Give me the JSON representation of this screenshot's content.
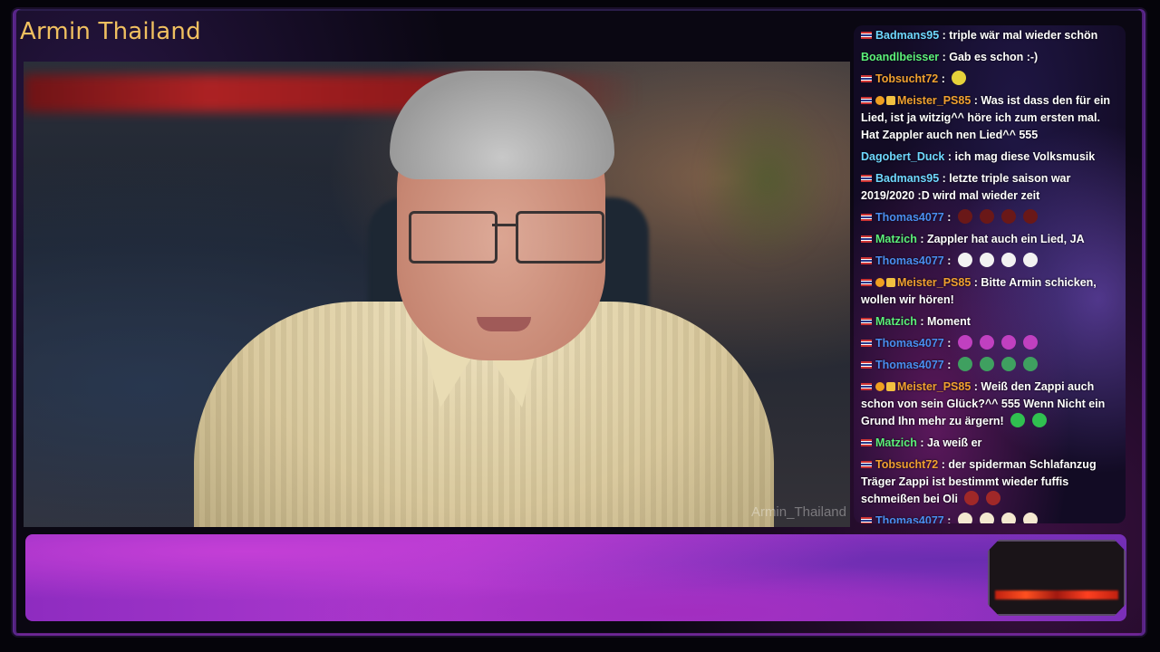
{
  "stream": {
    "title": "Armin Thailand",
    "watermark": "Armin_Thailand"
  },
  "colors": {
    "brand": "#f0c060",
    "username_green": "#5cf07a",
    "username_blue": "#4a8ef0",
    "username_orange": "#f0a030",
    "username_cyan": "#6fd8ff"
  },
  "chat": {
    "messages": [
      {
        "user": "Badmans95",
        "color": "#6fd8ff",
        "flag": true,
        "badges": [],
        "text": ": triple wär mal wieder schön",
        "emotes": []
      },
      {
        "user": "Boandlbeisser",
        "color": "#5cf07a",
        "flag": false,
        "badges": [],
        "text": ": Gab es schon :-)",
        "emotes": []
      },
      {
        "user": "Tobsucht72",
        "color": "#f0a030",
        "flag": true,
        "badges": [],
        "text": ":",
        "emotes": [
          "laugh-emote"
        ]
      },
      {
        "user": "Meister_PS85",
        "color": "#f0a030",
        "flag": true,
        "badges": [
          "mod-badge",
          "sub-badge"
        ],
        "text": ": Was ist dass den für ein Lied, ist ja witzig^^ höre ich zum ersten mal. Hat Zappler auch nen Lied^^ 555",
        "emotes": []
      },
      {
        "user": "Dagobert_Duck",
        "color": "#6fd8ff",
        "flag": false,
        "badges": [],
        "text": ": ich mag diese Volksmusik",
        "emotes": []
      },
      {
        "user": "Badmans95",
        "color": "#6fd8ff",
        "flag": true,
        "badges": [],
        "text": ": letzte triple saison war 2019/2020 :D wird mal wieder zeit",
        "emotes": []
      },
      {
        "user": "Thomas4077",
        "color": "#4a8ef0",
        "flag": true,
        "badges": [],
        "text": ":",
        "emotes": [
          "red-emote",
          "red-emote",
          "red-emote",
          "red-emote"
        ]
      },
      {
        "user": "Matzich",
        "color": "#5cf07a",
        "flag": true,
        "badges": [],
        "text": ": Zappler hat auch ein Lied, JA",
        "emotes": []
      },
      {
        "user": "Thomas4077",
        "color": "#4a8ef0",
        "flag": true,
        "badges": [],
        "text": ":",
        "emotes": [
          "ghost-emote",
          "ghost-emote",
          "ghost-emote",
          "ghost-emote"
        ]
      },
      {
        "user": "Meister_PS85",
        "color": "#f0a030",
        "flag": true,
        "badges": [
          "mod-badge",
          "sub-badge"
        ],
        "text": ": Bitte Armin schicken, wollen wir hören!",
        "emotes": []
      },
      {
        "user": "Matzich",
        "color": "#5cf07a",
        "flag": true,
        "badges": [],
        "text": ": Moment",
        "emotes": []
      },
      {
        "user": "Thomas4077",
        "color": "#4a8ef0",
        "flag": true,
        "badges": [],
        "text": ":",
        "emotes": [
          "pink-emote",
          "pink-emote",
          "pink-emote",
          "pink-emote"
        ]
      },
      {
        "user": "Thomas4077",
        "color": "#4a8ef0",
        "flag": true,
        "badges": [],
        "text": ":",
        "emotes": [
          "pepe-emote",
          "pepe-emote",
          "pepe-emote",
          "pepe-emote"
        ]
      },
      {
        "user": "Meister_PS85",
        "color": "#f0a030",
        "flag": true,
        "badges": [
          "mod-badge",
          "sub-badge"
        ],
        "text": ": Weiß den Zappi auch schon von sein Glück?^^ 555 Wenn Nicht ein Grund Ihn mehr zu ärgern!",
        "emotes": [
          "green-emote",
          "green-emote"
        ]
      },
      {
        "user": "Matzich",
        "color": "#5cf07a",
        "flag": true,
        "badges": [],
        "text": ": Ja weiß er",
        "emotes": []
      },
      {
        "user": "Tobsucht72",
        "color": "#f0a030",
        "flag": true,
        "badges": [],
        "text": ": der spiderman Schlafanzug Träger Zappi ist bestimmt wieder fuffis schmeißen bei Oli",
        "emotes": [
          "badge-emote",
          "badge-emote"
        ]
      },
      {
        "user": "Thomas4077",
        "color": "#4a8ef0",
        "flag": true,
        "badges": [],
        "text": ":",
        "emotes": [
          "hand-emote",
          "hand-emote",
          "hand-emote",
          "hand-emote"
        ]
      }
    ]
  }
}
